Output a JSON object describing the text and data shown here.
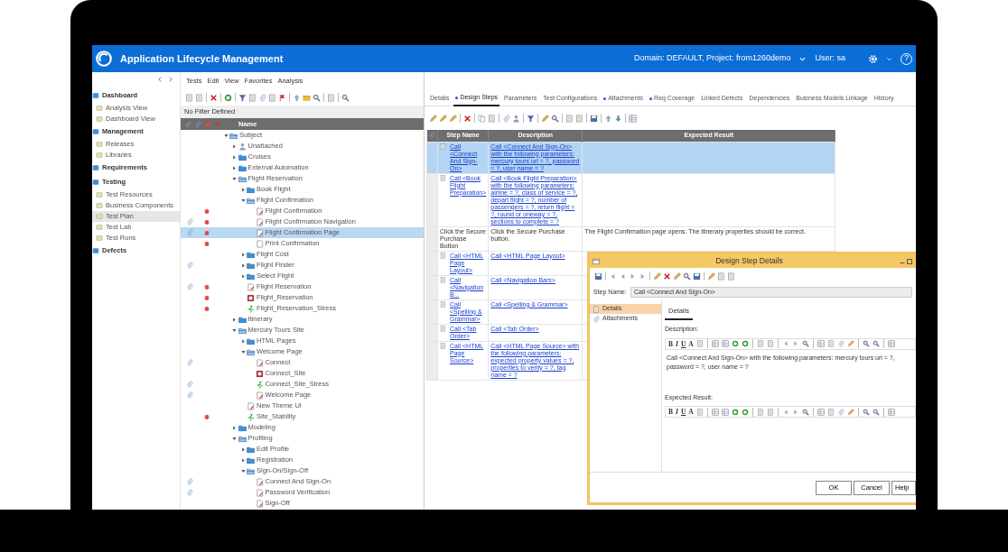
{
  "header": {
    "app_title": "Application Lifecycle Management",
    "domain": "Domain: DEFAULT, Project: from1260demo",
    "user": "User: sa",
    "help": "?"
  },
  "modules": [
    {
      "label": "Dashboard",
      "children": [
        {
          "label": "Analysis View",
          "selected": false
        },
        {
          "label": "Dashboard View",
          "selected": false
        }
      ]
    },
    {
      "label": "Management",
      "children": [
        {
          "label": "Releases",
          "selected": false
        },
        {
          "label": "Libraries",
          "selected": false
        }
      ]
    },
    {
      "label": "Requirements"
    },
    {
      "label": "Testing",
      "children": [
        {
          "label": "Test Resources",
          "selected": false
        },
        {
          "label": "Business Components",
          "selected": false
        },
        {
          "label": "Test Plan",
          "selected": true
        },
        {
          "label": "Test Lab",
          "selected": false
        },
        {
          "label": "Test Runs",
          "selected": false
        }
      ]
    },
    {
      "label": "Defects"
    }
  ],
  "menu": [
    "Tests",
    "Edit",
    "View",
    "Favorites",
    "Analysis"
  ],
  "filter": "No Filter Defined",
  "tree_header": "Name",
  "test_tree": [
    {
      "label": "Subject",
      "kind": "folder",
      "expanded": true,
      "attachment": false,
      "defect": false,
      "selected": false,
      "children": [
        {
          "label": "Unattached",
          "kind": "unattached",
          "expanded": false,
          "attachment": false,
          "defect": false,
          "selected": false
        },
        {
          "label": "Cruises",
          "kind": "folder",
          "expanded": false,
          "attachment": false,
          "defect": false,
          "selected": false
        },
        {
          "label": "External Automation",
          "kind": "folder",
          "expanded": false,
          "attachment": false,
          "defect": false,
          "selected": false
        },
        {
          "label": "Flight Reservation",
          "kind": "folder",
          "expanded": true,
          "attachment": false,
          "defect": false,
          "selected": false,
          "children": [
            {
              "label": "Book Flight",
              "kind": "folder",
              "expanded": false,
              "attachment": false,
              "defect": false,
              "selected": false
            },
            {
              "label": "Flight Confirmation",
              "kind": "folder",
              "expanded": true,
              "attachment": false,
              "defect": false,
              "selected": false,
              "children": [
                {
                  "label": "Flight Confirmation",
                  "kind": "manual",
                  "attachment": false,
                  "defect": true,
                  "selected": false
                },
                {
                  "label": "Flight Confirmation Navigation",
                  "kind": "manual",
                  "attachment": true,
                  "defect": true,
                  "selected": false
                },
                {
                  "label": "Flight Confirmation Page",
                  "kind": "manual",
                  "attachment": true,
                  "defect": true,
                  "selected": true
                },
                {
                  "label": "Print Confirmation",
                  "kind": "plain",
                  "attachment": false,
                  "defect": true,
                  "selected": false
                }
              ]
            },
            {
              "label": "Flight Cost",
              "kind": "folder",
              "expanded": false,
              "attachment": false,
              "defect": false,
              "selected": false
            },
            {
              "label": "Flight Finder",
              "kind": "folder",
              "expanded": false,
              "attachment": true,
              "defect": false,
              "selected": false
            },
            {
              "label": "Select Flight",
              "kind": "folder",
              "expanded": false,
              "attachment": false,
              "defect": false,
              "selected": false
            },
            {
              "label": "Flight Reservation",
              "kind": "manual",
              "attachment": true,
              "defect": true,
              "selected": false
            },
            {
              "label": "Flight_Reservation",
              "kind": "script",
              "attachment": false,
              "defect": true,
              "selected": false
            },
            {
              "label": "Flight_Reservation_Stress",
              "kind": "performance",
              "attachment": false,
              "defect": true,
              "selected": false
            }
          ]
        },
        {
          "label": "Itinerary",
          "kind": "folder",
          "expanded": false,
          "attachment": false,
          "defect": false,
          "selected": false
        },
        {
          "label": "Mercury Tours Site",
          "kind": "folder",
          "expanded": true,
          "attachment": false,
          "defect": false,
          "selected": false,
          "children": [
            {
              "label": "HTML Pages",
              "kind": "folder",
              "expanded": false,
              "attachment": false,
              "defect": false,
              "selected": false
            },
            {
              "label": "Welcome Page",
              "kind": "folder",
              "expanded": true,
              "attachment": false,
              "defect": false,
              "selected": false,
              "children": [
                {
                  "label": "Connect",
                  "kind": "manual",
                  "attachment": true,
                  "defect": false,
                  "selected": false
                },
                {
                  "label": "Connect_Site",
                  "kind": "script",
                  "attachment": false,
                  "defect": false,
                  "selected": false
                },
                {
                  "label": "Connect_Site_Stress",
                  "kind": "performance",
                  "attachment": true,
                  "defect": false,
                  "selected": false
                },
                {
                  "label": "Welcome Page",
                  "kind": "manual",
                  "attachment": true,
                  "defect": false,
                  "selected": false
                }
              ]
            },
            {
              "label": "New Theme UI",
              "kind": "manual",
              "attachment": false,
              "defect": false,
              "selected": false
            },
            {
              "label": "Site_Stability",
              "kind": "performance",
              "attachment": false,
              "defect": true,
              "selected": false
            }
          ]
        },
        {
          "label": "Modeling",
          "kind": "folder",
          "expanded": false,
          "attachment": false,
          "defect": false,
          "selected": false
        },
        {
          "label": "Profiling",
          "kind": "folder",
          "expanded": true,
          "attachment": false,
          "defect": false,
          "selected": false,
          "children": [
            {
              "label": "Edit Profile",
              "kind": "folder",
              "expanded": false,
              "attachment": false,
              "defect": false,
              "selected": false
            },
            {
              "label": "Registration",
              "kind": "folder",
              "expanded": false,
              "attachment": false,
              "defect": false,
              "selected": false
            },
            {
              "label": "Sign-On/Sign-Off",
              "kind": "folder",
              "expanded": true,
              "attachment": false,
              "defect": false,
              "selected": false,
              "children": [
                {
                  "label": "Connect And Sign-On",
                  "kind": "manual",
                  "attachment": true,
                  "defect": false,
                  "selected": false
                },
                {
                  "label": "Password Verification",
                  "kind": "manual",
                  "attachment": true,
                  "defect": false,
                  "selected": false
                },
                {
                  "label": "Sign-Off",
                  "kind": "manual",
                  "attachment": false,
                  "defect": false,
                  "selected": false
                }
              ]
            }
          ]
        }
      ]
    }
  ],
  "tabs": [
    {
      "label": "Details",
      "has_data": false,
      "selected": false
    },
    {
      "label": "Design Steps",
      "has_data": true,
      "selected": true
    },
    {
      "label": "Parameters",
      "has_data": false,
      "selected": false
    },
    {
      "label": "Test Configurations",
      "has_data": false,
      "selected": false
    },
    {
      "label": "Attachments",
      "has_data": true,
      "selected": false
    },
    {
      "label": "Req Coverage",
      "has_data": true,
      "selected": false
    },
    {
      "label": "Linked Defects",
      "has_data": false,
      "selected": false
    },
    {
      "label": "Dependencies",
      "has_data": false,
      "selected": false
    },
    {
      "label": "Business Models Linkage",
      "has_data": false,
      "selected": false
    },
    {
      "label": "History",
      "has_data": false,
      "selected": false
    }
  ],
  "steps": {
    "columns": [
      "Step Name",
      "Description",
      "Expected Result"
    ],
    "rows": [
      {
        "kind": "call",
        "step_name": "Call <Connect And Sign-On>",
        "description": "Call <Connect And Sign-On> with the following parameters: mercury tours url = ?, password = ?, user name = ?",
        "selected": true
      },
      {
        "kind": "call",
        "step_name": "Call <Book Flight Preparation>",
        "description": "Call <Book Flight Preparation> with the following parameters: airline = ?, class of service = ?, depart flight = ?, number of passengers = ?, return flight = ?, round or oneway = ?, sections to complete = ?",
        "selected": false
      },
      {
        "kind": "manual",
        "step_name": "Click the Secure Purchase Button",
        "description": "Click the Secure Purchase button.",
        "expected": "The Flight Confirmation page opens. The itinerary properties should be correct.",
        "selected": false
      },
      {
        "kind": "call",
        "step_name": "Call <HTML Page Layout>",
        "description": "Call <HTML Page Layout>",
        "selected": false
      },
      {
        "kind": "call",
        "step_name": "Call <Navigation B...",
        "description": "Call <Navigation Bars>",
        "selected": false
      },
      {
        "kind": "call",
        "step_name": "Call <Spelling & Grammar>",
        "description": "Call <Spelling & Grammar>",
        "selected": false
      },
      {
        "kind": "call",
        "step_name": "Call <Tab Order>",
        "description": "Call <Tab Order>",
        "selected": false
      },
      {
        "kind": "call",
        "step_name": "Call <HTML Page Source>",
        "description": "Call <HTML Page Source> with the following parameters: expected property values = ?, properties to verify = ?, tag name = ?",
        "selected": false
      }
    ]
  },
  "dialog": {
    "title": "Design Step Details",
    "step_name_label": "Step Name:",
    "step_name": "Call <Connect And Sign-On>",
    "nav": [
      {
        "label": "Details",
        "selected": true
      },
      {
        "label": "Attachments",
        "selected": false
      }
    ],
    "tabs": [
      {
        "label": "Details",
        "selected": true
      }
    ],
    "description_label": "Description:",
    "description_format": [
      "B",
      "I",
      "U",
      "A"
    ],
    "description": "Call <Connect And Sign-On> with the following parameters: mercury tours url = ?, password = ?, user name = ?",
    "expected_label": "Expected Result:",
    "expected_format": [
      "B",
      "I",
      "U",
      "A"
    ],
    "buttons": [
      "OK",
      "Cancel",
      "Help"
    ]
  }
}
